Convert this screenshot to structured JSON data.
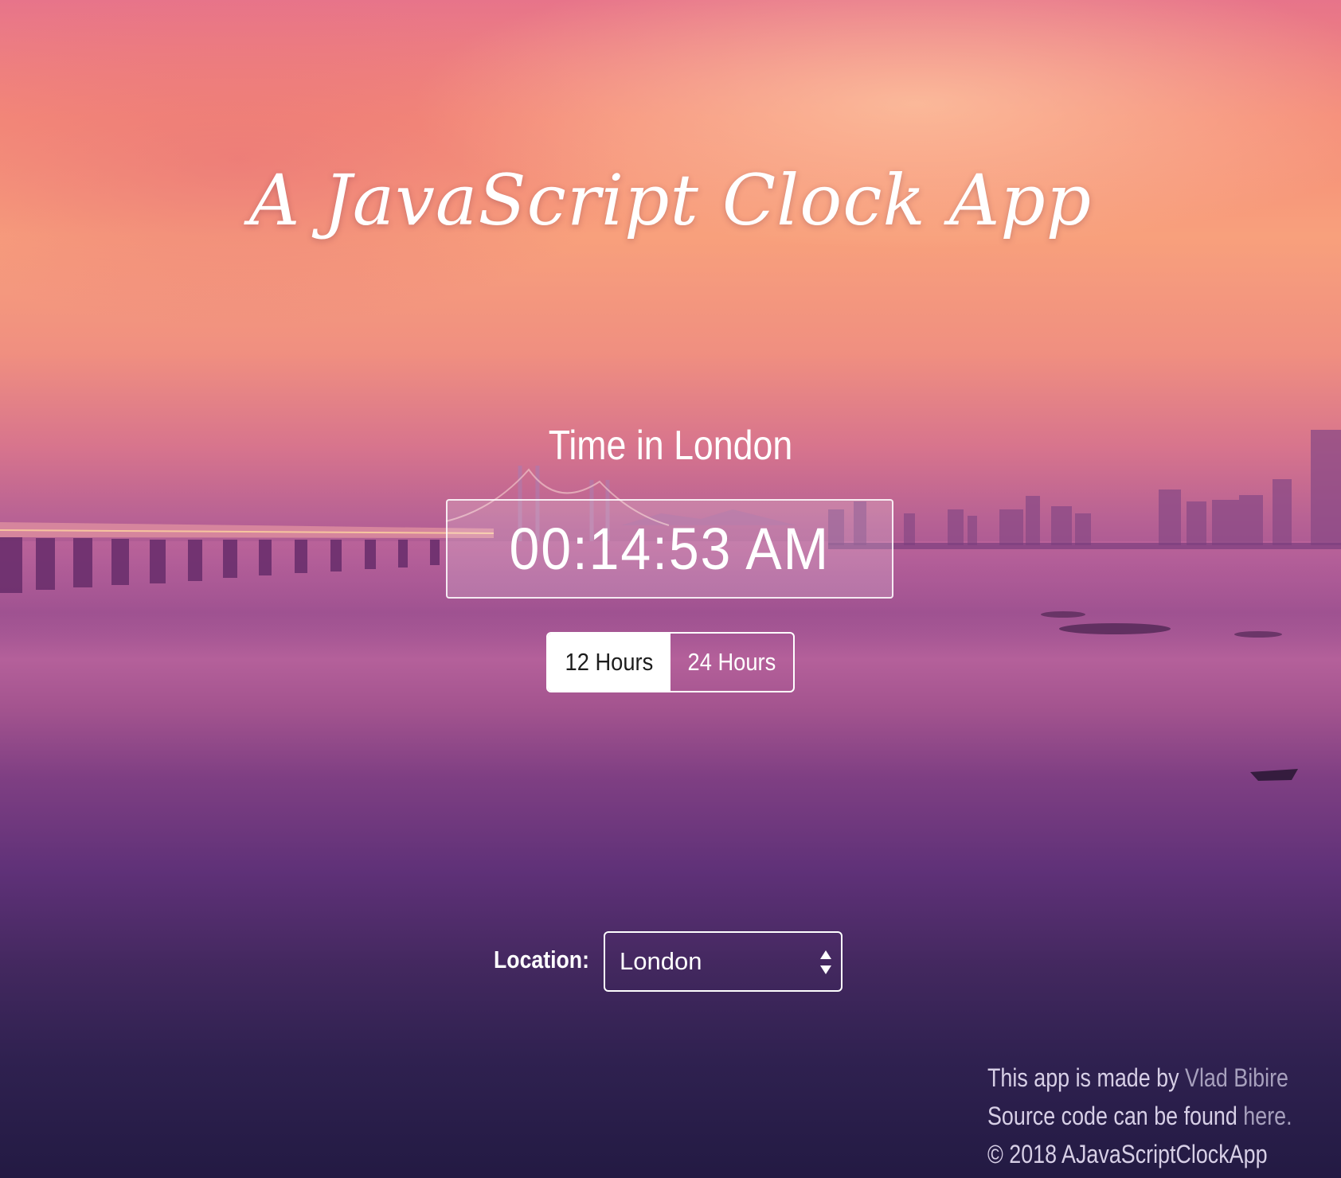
{
  "app": {
    "title": "A JavaScript Clock App"
  },
  "clock": {
    "heading": "Time in London",
    "time": "00:14:53 AM"
  },
  "format_toggle": {
    "options": [
      {
        "label": "12 Hours",
        "active": true
      },
      {
        "label": "24 Hours",
        "active": false
      }
    ]
  },
  "location": {
    "label": "Location:",
    "selected": "London"
  },
  "footer": {
    "made_by_prefix": "This app is made by ",
    "author_link": "Vlad Bibire",
    "source_prefix": "Source code can be found ",
    "source_link": "here.",
    "copyright": "© 2018 AJavaScriptClockApp"
  },
  "colors": {
    "text": "#ffffff",
    "active_toggle_bg": "#ffffff",
    "footer_text": "#d7cfe6",
    "footer_link": "#a7a0bd"
  }
}
